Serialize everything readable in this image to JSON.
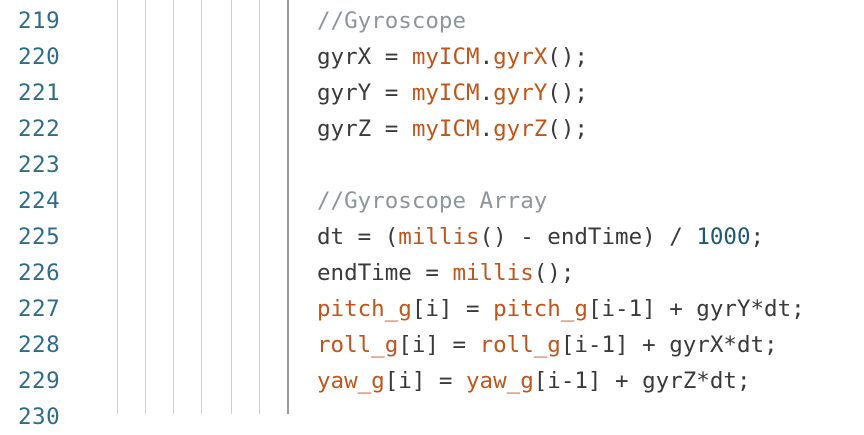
{
  "colors": {
    "line_number": "#2e6c8a",
    "plain": "#3a3a3a",
    "comment": "#8e969c",
    "identifier": "#c0561c",
    "number": "#1d5a6e"
  },
  "line_numbers": [
    "219",
    "220",
    "221",
    "222",
    "223",
    "224",
    "225",
    "226",
    "227",
    "228",
    "229",
    "230"
  ],
  "code_lines": [
    [
      {
        "t": "//Gyroscope",
        "c": "comment"
      }
    ],
    [
      {
        "t": "gyrX = ",
        "c": "plain"
      },
      {
        "t": "myICM",
        "c": "ident"
      },
      {
        "t": ".",
        "c": "plain"
      },
      {
        "t": "gyrX",
        "c": "ident"
      },
      {
        "t": "();",
        "c": "plain"
      }
    ],
    [
      {
        "t": "gyrY = ",
        "c": "plain"
      },
      {
        "t": "myICM",
        "c": "ident"
      },
      {
        "t": ".",
        "c": "plain"
      },
      {
        "t": "gyrY",
        "c": "ident"
      },
      {
        "t": "();",
        "c": "plain"
      }
    ],
    [
      {
        "t": "gyrZ = ",
        "c": "plain"
      },
      {
        "t": "myICM",
        "c": "ident"
      },
      {
        "t": ".",
        "c": "plain"
      },
      {
        "t": "gyrZ",
        "c": "ident"
      },
      {
        "t": "();",
        "c": "plain"
      }
    ],
    [],
    [
      {
        "t": "//Gyroscope Array",
        "c": "comment"
      }
    ],
    [
      {
        "t": "dt = (",
        "c": "plain"
      },
      {
        "t": "millis",
        "c": "ident"
      },
      {
        "t": "() - endTime) / ",
        "c": "plain"
      },
      {
        "t": "1000",
        "c": "num"
      },
      {
        "t": ";",
        "c": "plain"
      }
    ],
    [
      {
        "t": "endTime = ",
        "c": "plain"
      },
      {
        "t": "millis",
        "c": "ident"
      },
      {
        "t": "();",
        "c": "plain"
      }
    ],
    [
      {
        "t": "pitch_g",
        "c": "ident"
      },
      {
        "t": "[i] = ",
        "c": "plain"
      },
      {
        "t": "pitch_g",
        "c": "ident"
      },
      {
        "t": "[i-1] + gyrY*dt;",
        "c": "plain"
      }
    ],
    [
      {
        "t": "roll_g",
        "c": "ident"
      },
      {
        "t": "[i] = ",
        "c": "plain"
      },
      {
        "t": "roll_g",
        "c": "ident"
      },
      {
        "t": "[i-1] + gyrX*dt;",
        "c": "plain"
      }
    ],
    [
      {
        "t": "yaw_g",
        "c": "ident"
      },
      {
        "t": "[i] = ",
        "c": "plain"
      },
      {
        "t": "yaw_g",
        "c": "ident"
      },
      {
        "t": "[i-1] + gyrZ*dt;",
        "c": "plain"
      }
    ],
    []
  ]
}
